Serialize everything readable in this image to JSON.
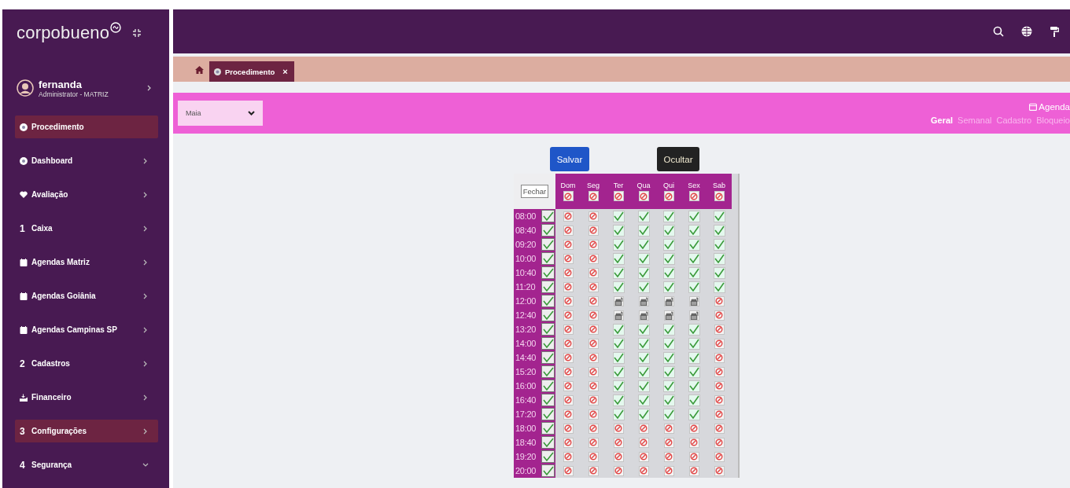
{
  "brand": {
    "name": "corpobueno"
  },
  "user": {
    "name": "fernanda",
    "role": "Administrator - MATRIZ"
  },
  "sidebar": {
    "items": [
      {
        "label": "Procedimento",
        "kind": "link",
        "selected": true
      },
      {
        "label": "Dashboard",
        "kind": "group",
        "expanded": false,
        "selected": false
      },
      {
        "label": "Avaliação",
        "kind": "group",
        "expanded": false,
        "selected": false
      },
      {
        "label": "Caixa",
        "glyph": "1",
        "kind": "group",
        "expanded": false,
        "selected": false
      },
      {
        "label": "Agendas Matriz",
        "kind": "group",
        "expanded": false,
        "selected": false
      },
      {
        "label": "Agendas Goiânia",
        "kind": "group",
        "expanded": false,
        "selected": false
      },
      {
        "label": "Agendas Campinas SP",
        "kind": "group",
        "expanded": false,
        "selected": false
      },
      {
        "label": "Cadastros",
        "glyph": "2",
        "kind": "group",
        "expanded": false,
        "selected": false
      },
      {
        "label": "Financeiro",
        "kind": "group",
        "expanded": false,
        "selected": false
      },
      {
        "label": "Configurações",
        "glyph": "3",
        "kind": "group",
        "expanded": false,
        "selected": true
      },
      {
        "label": "Segurança",
        "glyph": "4",
        "kind": "group",
        "expanded": true,
        "selected": false
      }
    ]
  },
  "tabs": [
    {
      "label": "Procedimento",
      "close": "×",
      "selected": true
    }
  ],
  "filter": {
    "value": "Maia"
  },
  "agenda": {
    "title": "Agenda",
    "tabs": [
      {
        "label": "Geral",
        "selected": true
      },
      {
        "label": "Semanal",
        "selected": false
      },
      {
        "label": "Cadastro",
        "selected": false
      },
      {
        "label": "Bloqueio",
        "selected": false
      }
    ]
  },
  "actions": {
    "save": "Salvar",
    "hide": "Ocultar"
  },
  "grid": {
    "close": "Fechar",
    "days": [
      {
        "label": "Dom",
        "blocked": true
      },
      {
        "label": "Seg",
        "blocked": true
      },
      {
        "label": "Ter",
        "blocked": true
      },
      {
        "label": "Qua",
        "blocked": true
      },
      {
        "label": "Qui",
        "blocked": true
      },
      {
        "label": "Sex",
        "blocked": true
      },
      {
        "label": "Sab",
        "blocked": true
      }
    ],
    "rows": [
      {
        "time": "08:00",
        "checked": true,
        "cells": [
          {
            "kind": "no"
          },
          {
            "kind": "no"
          },
          {
            "kind": "ok"
          },
          {
            "kind": "ok"
          },
          {
            "kind": "ok"
          },
          {
            "kind": "ok"
          },
          {
            "kind": "ok"
          }
        ]
      },
      {
        "time": "08:40",
        "checked": true,
        "cells": [
          {
            "kind": "no"
          },
          {
            "kind": "no"
          },
          {
            "kind": "ok"
          },
          {
            "kind": "ok"
          },
          {
            "kind": "ok"
          },
          {
            "kind": "ok"
          },
          {
            "kind": "ok"
          }
        ]
      },
      {
        "time": "09:20",
        "checked": true,
        "cells": [
          {
            "kind": "no"
          },
          {
            "kind": "no"
          },
          {
            "kind": "ok"
          },
          {
            "kind": "ok"
          },
          {
            "kind": "ok"
          },
          {
            "kind": "ok"
          },
          {
            "kind": "ok"
          }
        ]
      },
      {
        "time": "10:00",
        "checked": true,
        "cells": [
          {
            "kind": "no"
          },
          {
            "kind": "no"
          },
          {
            "kind": "ok"
          },
          {
            "kind": "ok"
          },
          {
            "kind": "ok"
          },
          {
            "kind": "ok"
          },
          {
            "kind": "ok"
          }
        ]
      },
      {
        "time": "10:40",
        "checked": true,
        "cells": [
          {
            "kind": "no"
          },
          {
            "kind": "no"
          },
          {
            "kind": "ok"
          },
          {
            "kind": "ok"
          },
          {
            "kind": "ok"
          },
          {
            "kind": "ok"
          },
          {
            "kind": "ok"
          }
        ]
      },
      {
        "time": "11:20",
        "checked": true,
        "cells": [
          {
            "kind": "no"
          },
          {
            "kind": "no"
          },
          {
            "kind": "ok"
          },
          {
            "kind": "ok"
          },
          {
            "kind": "ok"
          },
          {
            "kind": "ok"
          },
          {
            "kind": "ok"
          }
        ]
      },
      {
        "time": "12:00",
        "checked": true,
        "cells": [
          {
            "kind": "no"
          },
          {
            "kind": "no"
          },
          {
            "kind": "break"
          },
          {
            "kind": "break"
          },
          {
            "kind": "break"
          },
          {
            "kind": "break"
          },
          {
            "kind": "no"
          }
        ]
      },
      {
        "time": "12:40",
        "checked": true,
        "cells": [
          {
            "kind": "no"
          },
          {
            "kind": "no"
          },
          {
            "kind": "break"
          },
          {
            "kind": "break"
          },
          {
            "kind": "break"
          },
          {
            "kind": "break"
          },
          {
            "kind": "no"
          }
        ]
      },
      {
        "time": "13:20",
        "checked": true,
        "cells": [
          {
            "kind": "no"
          },
          {
            "kind": "no"
          },
          {
            "kind": "ok"
          },
          {
            "kind": "ok"
          },
          {
            "kind": "ok"
          },
          {
            "kind": "ok"
          },
          {
            "kind": "no"
          }
        ]
      },
      {
        "time": "14:00",
        "checked": true,
        "cells": [
          {
            "kind": "no"
          },
          {
            "kind": "no"
          },
          {
            "kind": "ok"
          },
          {
            "kind": "ok"
          },
          {
            "kind": "ok"
          },
          {
            "kind": "ok"
          },
          {
            "kind": "no"
          }
        ]
      },
      {
        "time": "14:40",
        "checked": true,
        "cells": [
          {
            "kind": "no"
          },
          {
            "kind": "no"
          },
          {
            "kind": "ok"
          },
          {
            "kind": "ok"
          },
          {
            "kind": "ok"
          },
          {
            "kind": "ok"
          },
          {
            "kind": "no"
          }
        ]
      },
      {
        "time": "15:20",
        "checked": true,
        "cells": [
          {
            "kind": "no"
          },
          {
            "kind": "no"
          },
          {
            "kind": "ok"
          },
          {
            "kind": "ok"
          },
          {
            "kind": "ok"
          },
          {
            "kind": "ok"
          },
          {
            "kind": "no"
          }
        ]
      },
      {
        "time": "16:00",
        "checked": true,
        "cells": [
          {
            "kind": "no"
          },
          {
            "kind": "no"
          },
          {
            "kind": "ok"
          },
          {
            "kind": "ok"
          },
          {
            "kind": "ok"
          },
          {
            "kind": "ok"
          },
          {
            "kind": "no"
          }
        ]
      },
      {
        "time": "16:40",
        "checked": true,
        "cells": [
          {
            "kind": "no"
          },
          {
            "kind": "no"
          },
          {
            "kind": "ok"
          },
          {
            "kind": "ok"
          },
          {
            "kind": "ok"
          },
          {
            "kind": "ok"
          },
          {
            "kind": "no"
          }
        ]
      },
      {
        "time": "17:20",
        "checked": true,
        "cells": [
          {
            "kind": "no"
          },
          {
            "kind": "no"
          },
          {
            "kind": "ok"
          },
          {
            "kind": "ok"
          },
          {
            "kind": "ok"
          },
          {
            "kind": "ok"
          },
          {
            "kind": "no"
          }
        ]
      },
      {
        "time": "18:00",
        "checked": true,
        "cells": [
          {
            "kind": "no"
          },
          {
            "kind": "no"
          },
          {
            "kind": "no"
          },
          {
            "kind": "no"
          },
          {
            "kind": "no"
          },
          {
            "kind": "no"
          },
          {
            "kind": "no"
          }
        ]
      },
      {
        "time": "18:40",
        "checked": true,
        "cells": [
          {
            "kind": "no"
          },
          {
            "kind": "no"
          },
          {
            "kind": "no"
          },
          {
            "kind": "no"
          },
          {
            "kind": "no"
          },
          {
            "kind": "no"
          },
          {
            "kind": "no"
          }
        ]
      },
      {
        "time": "19:20",
        "checked": true,
        "cells": [
          {
            "kind": "no"
          },
          {
            "kind": "no"
          },
          {
            "kind": "no"
          },
          {
            "kind": "no"
          },
          {
            "kind": "no"
          },
          {
            "kind": "no"
          },
          {
            "kind": "no"
          }
        ]
      },
      {
        "time": "20:00",
        "checked": true,
        "cells": [
          {
            "kind": "no"
          },
          {
            "kind": "no"
          },
          {
            "kind": "no"
          },
          {
            "kind": "no"
          },
          {
            "kind": "no"
          },
          {
            "kind": "no"
          },
          {
            "kind": "no"
          }
        ]
      }
    ]
  }
}
